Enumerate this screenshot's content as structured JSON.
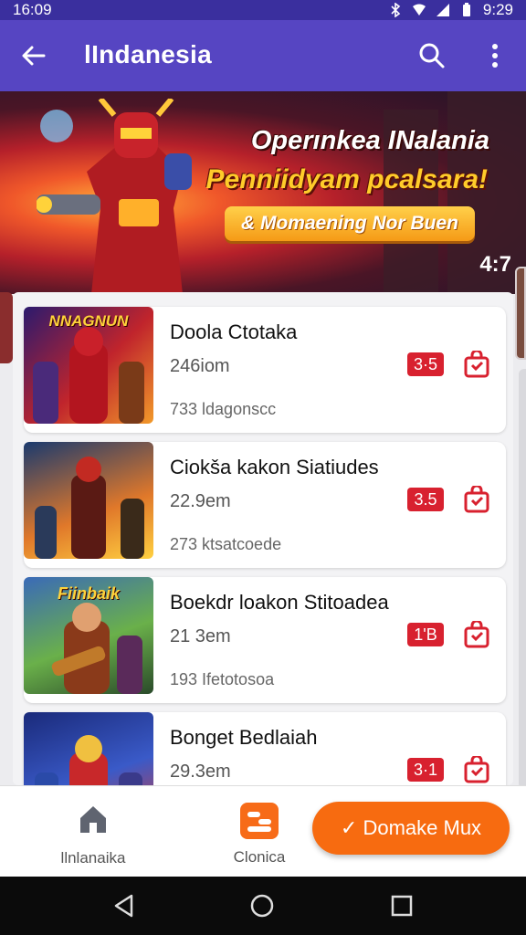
{
  "status_bar": {
    "time_left": "16:09",
    "time_right": "9:29"
  },
  "app_bar": {
    "title": "lIndanesia"
  },
  "banner": {
    "headline": "Operınkea INalania",
    "subline": "Penniidyam pcalsara!",
    "cta": "& Momaening Nor Buen",
    "counter": "4:7"
  },
  "items": [
    {
      "thumb_caption": "NNAGNUN",
      "name": "Doola Ctotaka",
      "size": "246iom",
      "meta": "733 ldagonscc",
      "rating": "3·5"
    },
    {
      "thumb_caption": "",
      "name": "Ciokša kakon Siatiudes",
      "size": "22.9em",
      "meta": "273 ktsatcoede",
      "rating": "3.5"
    },
    {
      "thumb_caption": "Fiinbaik",
      "name": "Boekdr loakon Stitoadea",
      "size": "21 3em",
      "meta": "193 Ifetotosoa",
      "rating": "1'B"
    },
    {
      "thumb_caption": "",
      "name": "Bonget Bedlaiah",
      "size": "29.3em",
      "meta": "",
      "rating": "3·1"
    }
  ],
  "bottom_bar": {
    "home_label": "llnlanaika",
    "category_label": "Clonica",
    "action_label": "✓ Domake Mux"
  },
  "colors": {
    "primary": "#5645c2",
    "accent": "#f76b10",
    "rating": "#d8212f"
  }
}
